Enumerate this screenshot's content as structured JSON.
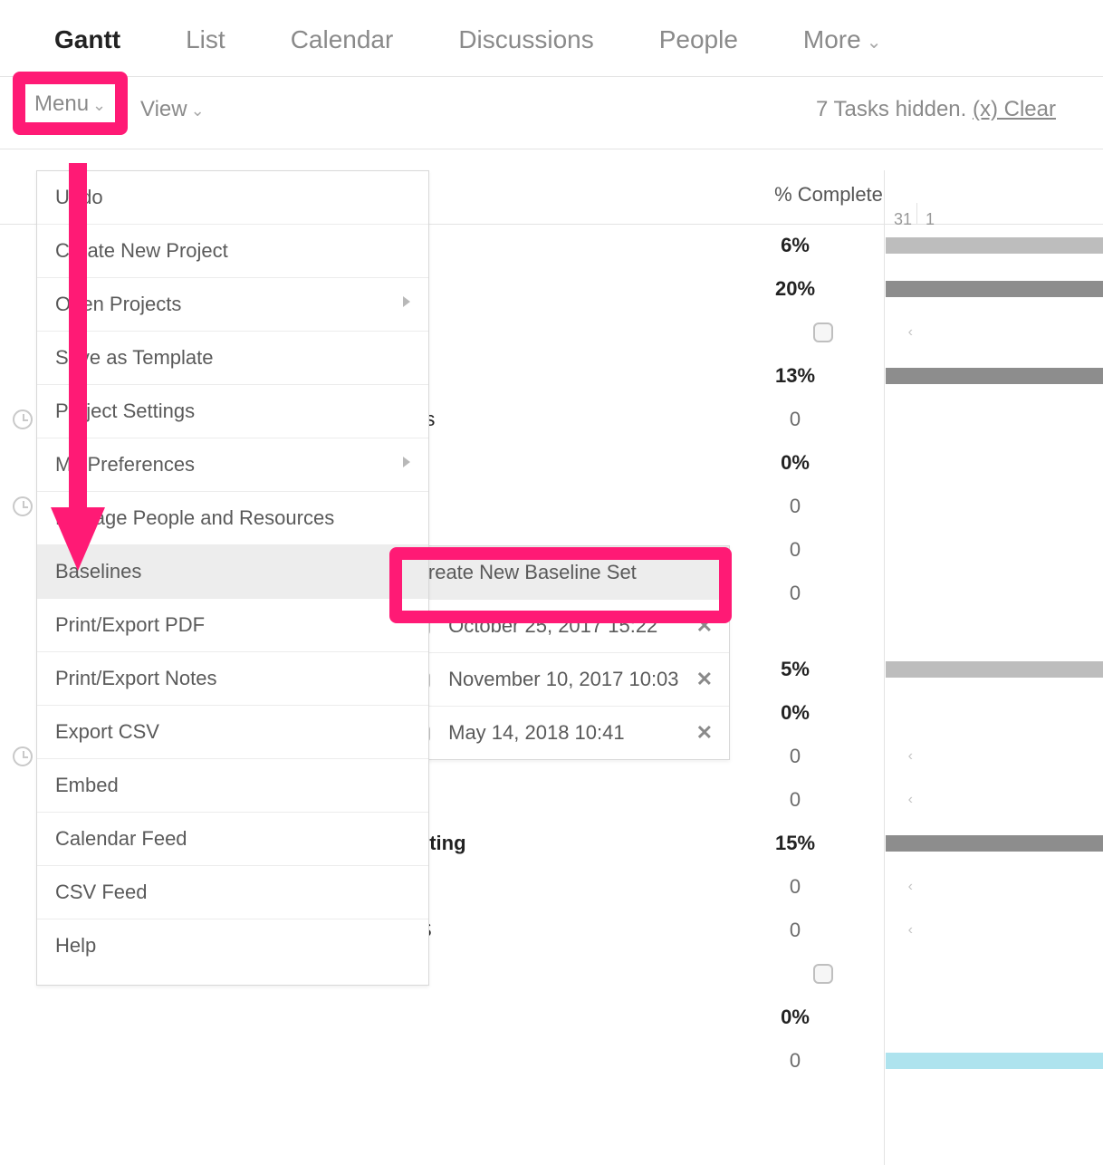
{
  "tabs": {
    "gantt": "Gantt",
    "list": "List",
    "calendar": "Calendar",
    "discussions": "Discussions",
    "people": "People",
    "more": "More"
  },
  "toolbar": {
    "menu_label": "Menu",
    "view_label": "View",
    "hidden_text": "7 Tasks hidden. ",
    "clear_link": "(x) Clear"
  },
  "columns": {
    "pct_complete": "% Complete",
    "day31": "31",
    "day1": "1"
  },
  "rows": {
    "r1": "6%",
    "r2": "20%",
    "r3_text": "s",
    "r3": "13%",
    "r4_text": "rs",
    "r4": "0",
    "r5": "0%",
    "r6": "0",
    "r7": "0",
    "r8": "0",
    "r10": "5%",
    "r11": "0%",
    "r12": "0",
    "r13": "0",
    "r14_text": "sting",
    "r14": "15%",
    "r15": "0",
    "r16_text": "S",
    "r16": "0",
    "r18": "0%",
    "r19": "0"
  },
  "menu": {
    "undo": "Undo",
    "create_new_project": "Create New Project",
    "open_projects": "Open Projects",
    "save_as_template": "Save as Template",
    "project_settings": "Project Settings",
    "my_preferences": "My Preferences",
    "manage_people": "Manage People and Resources",
    "baselines": "Baselines",
    "print_pdf": "Print/Export PDF",
    "print_notes": "Print/Export Notes",
    "export_csv": "Export CSV",
    "embed": "Embed",
    "calendar_feed": "Calendar Feed",
    "csv_feed": "CSV Feed",
    "help": "Help"
  },
  "submenu": {
    "create": "Create New Baseline Set",
    "b1": "October 25, 2017 15:22",
    "b2": "November 10, 2017 10:03",
    "b3": "May 14, 2018 10:41"
  },
  "annotation": {
    "highlight_color": "#ff1a75"
  }
}
